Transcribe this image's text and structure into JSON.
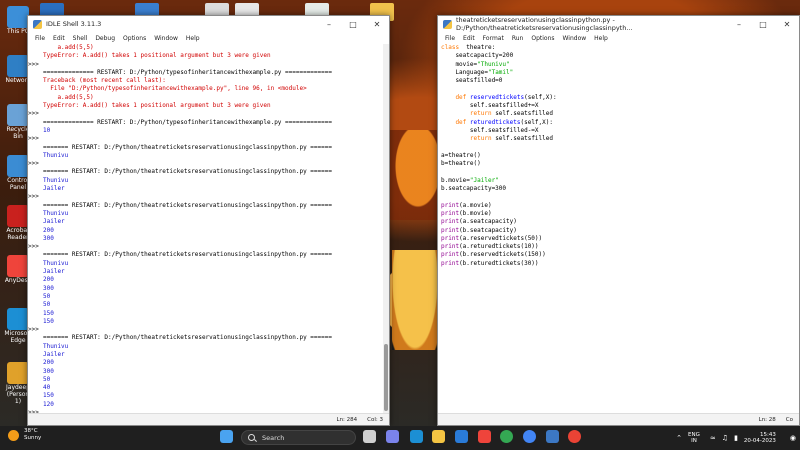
{
  "desktop": {
    "icons": [
      {
        "label": "This PC",
        "color": "#3c8fd8"
      },
      {
        "label": "Network",
        "color": "#2f7fc5"
      },
      {
        "label": "Recycle Bin",
        "color": "#6aa2d6"
      },
      {
        "label": "Control Panel",
        "color": "#3b8cd3"
      },
      {
        "label": "Acrobat Reader",
        "color": "#c9211e"
      },
      {
        "label": "AnyDesk",
        "color": "#ef443b"
      },
      {
        "label": "Microsoft Edge",
        "color": "#1c8fd4"
      },
      {
        "label": "Jaydeep (Person 1)",
        "color": "#e0a12a"
      }
    ]
  },
  "shell": {
    "title": "IDLE Shell 3.11.3",
    "menu": [
      "File",
      "Edit",
      "Shell",
      "Debug",
      "Options",
      "Window",
      "Help"
    ],
    "lines": [
      {
        "p": "",
        "t": "    a.add(5,5)",
        "c": "c-err"
      },
      {
        "p": "",
        "t": "TypeError: A.add() takes 1 positional argument but 3 were given",
        "c": "c-err"
      },
      {
        "p": ">>>",
        "t": "",
        "c": "c-def"
      },
      {
        "p": "",
        "t": "============== RESTART: D:/Python/typesofinheritancewithexample.py =============",
        "c": "c-def"
      },
      {
        "p": "",
        "t": "Traceback (most recent call last):",
        "c": "c-err"
      },
      {
        "p": "",
        "t": "  File \"D:/Python/typesofinheritancewithexample.py\", line 96, in <module>",
        "c": "c-err"
      },
      {
        "p": "",
        "t": "    a.add(5,5)",
        "c": "c-err"
      },
      {
        "p": "",
        "t": "TypeError: A.add() takes 1 positional argument but 3 were given",
        "c": "c-err"
      },
      {
        "p": ">>>",
        "t": "",
        "c": "c-def"
      },
      {
        "p": "",
        "t": "============== RESTART: D:/Python/typesofinheritancewithexample.py =============",
        "c": "c-def"
      },
      {
        "p": "",
        "t": "10",
        "c": "c-out"
      },
      {
        "p": ">>>",
        "t": "",
        "c": "c-def"
      },
      {
        "p": "",
        "t": "======= RESTART: D:/Python/theatreticketsreservationusingclassinpython.py ======",
        "c": "c-def"
      },
      {
        "p": "",
        "t": "Thunivu",
        "c": "c-out"
      },
      {
        "p": ">>>",
        "t": "",
        "c": "c-def"
      },
      {
        "p": "",
        "t": "======= RESTART: D:/Python/theatreticketsreservationusingclassinpython.py ======",
        "c": "c-def"
      },
      {
        "p": "",
        "t": "Thunivu",
        "c": "c-out"
      },
      {
        "p": "",
        "t": "Jailer",
        "c": "c-out"
      },
      {
        "p": ">>>",
        "t": "",
        "c": "c-def"
      },
      {
        "p": "",
        "t": "======= RESTART: D:/Python/theatreticketsreservationusingclassinpython.py ======",
        "c": "c-def"
      },
      {
        "p": "",
        "t": "Thunivu",
        "c": "c-out"
      },
      {
        "p": "",
        "t": "Jailer",
        "c": "c-out"
      },
      {
        "p": "",
        "t": "200",
        "c": "c-out"
      },
      {
        "p": "",
        "t": "300",
        "c": "c-out"
      },
      {
        "p": ">>>",
        "t": "",
        "c": "c-def"
      },
      {
        "p": "",
        "t": "======= RESTART: D:/Python/theatreticketsreservationusingclassinpython.py ======",
        "c": "c-def"
      },
      {
        "p": "",
        "t": "Thunivu",
        "c": "c-out"
      },
      {
        "p": "",
        "t": "Jailer",
        "c": "c-out"
      },
      {
        "p": "",
        "t": "200",
        "c": "c-out"
      },
      {
        "p": "",
        "t": "300",
        "c": "c-out"
      },
      {
        "p": "",
        "t": "50",
        "c": "c-out"
      },
      {
        "p": "",
        "t": "50",
        "c": "c-out"
      },
      {
        "p": "",
        "t": "150",
        "c": "c-out"
      },
      {
        "p": "",
        "t": "150",
        "c": "c-out"
      },
      {
        "p": ">>>",
        "t": "",
        "c": "c-def"
      },
      {
        "p": "",
        "t": "======= RESTART: D:/Python/theatreticketsreservationusingclassinpython.py ======",
        "c": "c-def"
      },
      {
        "p": "",
        "t": "Thunivu",
        "c": "c-out"
      },
      {
        "p": "",
        "t": "Jailer",
        "c": "c-out"
      },
      {
        "p": "",
        "t": "200",
        "c": "c-out"
      },
      {
        "p": "",
        "t": "300",
        "c": "c-out"
      },
      {
        "p": "",
        "t": "50",
        "c": "c-out"
      },
      {
        "p": "",
        "t": "40",
        "c": "c-out"
      },
      {
        "p": "",
        "t": "150",
        "c": "c-out"
      },
      {
        "p": "",
        "t": "120",
        "c": "c-out"
      },
      {
        "p": ">>>",
        "t": "",
        "c": "c-def"
      }
    ],
    "status_ln": "Ln: 284",
    "status_col": "Col: 3"
  },
  "editor": {
    "title": "theatreticketsreservationusingclassinpython.py - D:/Python/theatreticketsreservationusingclassinpyth...",
    "menu": [
      "File",
      "Edit",
      "Format",
      "Run",
      "Options",
      "Window",
      "Help"
    ],
    "code": [
      [
        [
          "kw",
          "class"
        ],
        [
          "",
          "  theatre:"
        ]
      ],
      [
        [
          "",
          "    seatcapacity=200"
        ]
      ],
      [
        [
          "",
          "    movie="
        ],
        [
          "str",
          "\"Thunivu\""
        ]
      ],
      [
        [
          "",
          "    Language="
        ],
        [
          "str",
          "\"Tamil\""
        ]
      ],
      [
        [
          "",
          "    seatsfilled=0"
        ]
      ],
      [
        [
          "",
          ""
        ]
      ],
      [
        [
          "kw",
          "    def"
        ],
        [
          "fn",
          " reservedtickets"
        ],
        [
          "",
          "(self,X):"
        ]
      ],
      [
        [
          "",
          "        self.seatsfilled+=X"
        ]
      ],
      [
        [
          "kw",
          "        return"
        ],
        [
          "",
          " self.seatsfilled"
        ]
      ],
      [
        [
          "kw",
          "    def"
        ],
        [
          "fn",
          " returedtickets"
        ],
        [
          "",
          "(self,X):"
        ]
      ],
      [
        [
          "",
          "        self.seatsfilled-=X"
        ]
      ],
      [
        [
          "kw",
          "        return"
        ],
        [
          "",
          " self.seatsfilled"
        ]
      ],
      [
        [
          "",
          ""
        ]
      ],
      [
        [
          "",
          "a=theatre()"
        ]
      ],
      [
        [
          "",
          "b=theatre()"
        ]
      ],
      [
        [
          "",
          ""
        ]
      ],
      [
        [
          "",
          "b.movie="
        ],
        [
          "str",
          "\"Jailer\""
        ]
      ],
      [
        [
          "",
          "b.seatcapacity=300"
        ]
      ],
      [
        [
          "",
          ""
        ]
      ],
      [
        [
          "bi",
          "print"
        ],
        [
          "",
          "(a.movie)"
        ]
      ],
      [
        [
          "bi",
          "print"
        ],
        [
          "",
          "(b.movie)"
        ]
      ],
      [
        [
          "bi",
          "print"
        ],
        [
          "",
          "(a.seatcapacity)"
        ]
      ],
      [
        [
          "bi",
          "print"
        ],
        [
          "",
          "(b.seatcapacity)"
        ]
      ],
      [
        [
          "bi",
          "print"
        ],
        [
          "",
          "(a.reservedtickets(50))"
        ]
      ],
      [
        [
          "bi",
          "print"
        ],
        [
          "",
          "(a.returedtickets(10))"
        ]
      ],
      [
        [
          "bi",
          "print"
        ],
        [
          "",
          "(b.reservedtickets(150))"
        ]
      ],
      [
        [
          "bi",
          "print"
        ],
        [
          "",
          "(b.returedtickets(30))"
        ]
      ]
    ],
    "status_ln": "Ln: 28",
    "status_col": "Co"
  },
  "taskbar": {
    "temp": "38°C",
    "weather": "Sunny",
    "search_placeholder": "Search",
    "lang_1": "ENG",
    "lang_2": "IN",
    "time": "15:43",
    "date": "20-04-2023",
    "pinned": [
      {
        "name": "start-icon",
        "color": "#4aa3f0"
      },
      {
        "name": "task-view-icon",
        "color": "#cfcfcf"
      },
      {
        "name": "chat-icon",
        "color": "#7b83eb"
      },
      {
        "name": "edge-icon",
        "color": "#1c8fd4"
      },
      {
        "name": "file-explorer-icon",
        "color": "#f4c443"
      },
      {
        "name": "mail-icon",
        "color": "#2a7bd8"
      },
      {
        "name": "anydesk-icon",
        "color": "#ef443b"
      },
      {
        "name": "chrome-icon",
        "color": "#34a853"
      },
      {
        "name": "chrome-2-icon",
        "color": "#4285f4"
      },
      {
        "name": "idle-icon",
        "color": "#3c78c4"
      },
      {
        "name": "chrome-3-icon",
        "color": "#ea4335"
      }
    ]
  }
}
